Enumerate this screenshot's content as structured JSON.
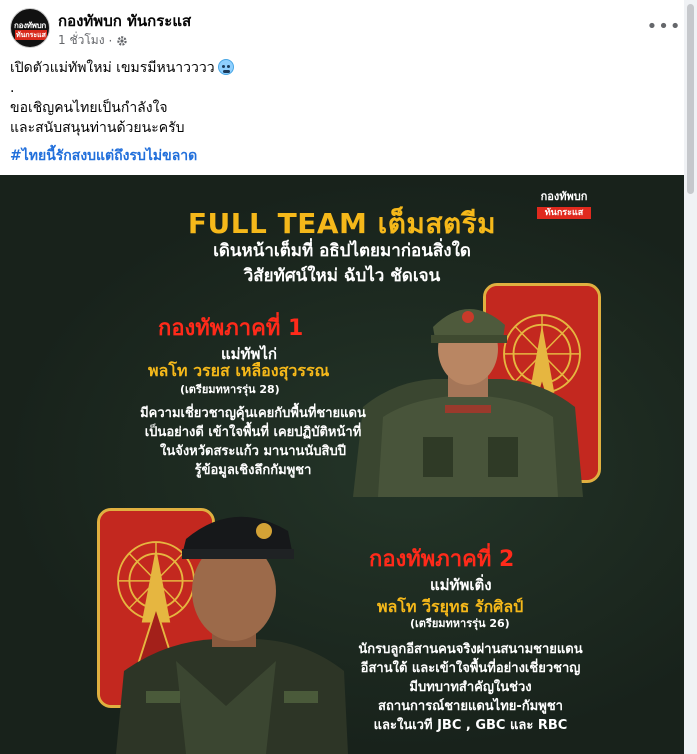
{
  "post": {
    "page_name": "กองทัพบก ทันกระแส",
    "time": "1 ชั่วโมง",
    "privacy_separator": "·",
    "more_label": "•••",
    "avatar": {
      "line1": "กองทัพบก",
      "line2": "ทันกระแส"
    },
    "caption": {
      "line1": "เปิดตัวแม่ทัพใหม่  เขมรมีหนาวววว",
      "line2": ".",
      "line3": "ขอเชิญคนไทยเป็นกำลังใจ",
      "line4": "และสนับสนุนท่านด้วยนะครับ",
      "hashtag": "#ไทยนี้รักสงบแต่ถึงรบไม่ขลาด"
    }
  },
  "poster": {
    "logo": {
      "line1": "กองทัพบก",
      "line2": "ทันกระแส"
    },
    "title": "FULL TEAM เต็มสตรีม",
    "subtitle1": "เดินหน้าเต็มที่ อธิปไตยมาก่อนสิ่งใด",
    "subtitle2": "วิสัยทัศน์ใหม่ ฉับไว ชัดเจน",
    "army1": {
      "heading": "กองทัพภาคที่ 1",
      "nickname": "แม่ทัพไก่",
      "name": "พลโท วรยส เหลืองสุวรรณ",
      "class": "(เตรียมทหารรุ่น 28)",
      "desc": [
        "มีความเชี่ยวชาญคุ้นเคยกับพื้นที่ชายแดน",
        "เป็นอย่างดี เข้าใจพื้นที่ เคยปฏิบัติหน้าที่",
        "ในจังหวัดสระแก้ว มานานนับสิบปี",
        "รู้ข้อมูลเชิงลึกกัมพูชา"
      ]
    },
    "army2": {
      "heading": "กองทัพภาคที่ 2",
      "nickname": "แม่ทัพเติ่ง",
      "name": "พลโท วีรยุทธ รักศิลป์",
      "class": "(เตรียมทหารรุ่น 26)",
      "desc": [
        "นักรบลูกอีสานคนจริงผ่านสนามชายแดน",
        "อีสานใต้ และเข้าใจพื้นที่อย่างเชี่ยวชาญ",
        "มีบทบาทสำคัญในช่วง",
        "สถานการณ์ชายแดนไทย-กัมพูชา",
        "และในเวที JBC , GBC และ RBC"
      ]
    }
  },
  "colors": {
    "hashtag": "#216fdb",
    "title_gold": "#f5b81a",
    "heading_red": "#ff2a1a",
    "poster_bg": "#1a261e"
  }
}
